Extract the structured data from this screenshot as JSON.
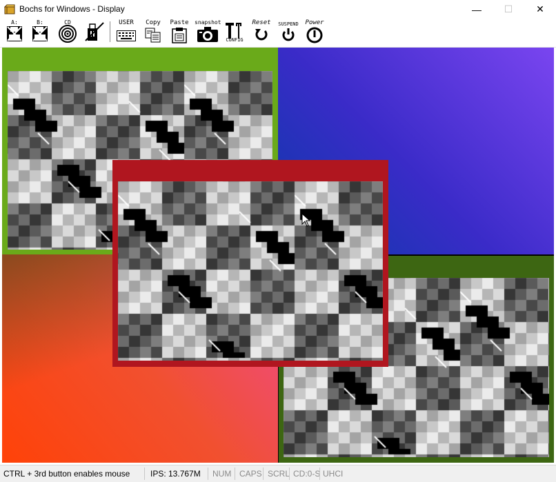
{
  "window": {
    "title": "Bochs for Windows - Display",
    "controls": {
      "minimize": "—",
      "maximize": "☐",
      "close": "✕"
    }
  },
  "toolbar": {
    "buttons": [
      {
        "id": "floppy-a",
        "label": "A:",
        "icon": "floppy-icon"
      },
      {
        "id": "floppy-b",
        "label": "B:",
        "icon": "floppy-icon"
      },
      {
        "id": "cdrom",
        "label": "CD",
        "icon": "cd-icon"
      },
      {
        "id": "usb",
        "label": "",
        "icon": "usb-icon"
      },
      {
        "id": "user",
        "label": "USER",
        "icon": "keyboard-icon"
      },
      {
        "id": "copy",
        "label": "Copy",
        "icon": "copy-icon"
      },
      {
        "id": "paste",
        "label": "Paste",
        "icon": "paste-icon"
      },
      {
        "id": "snapshot",
        "label": "snapshot",
        "icon": "camera-icon"
      },
      {
        "id": "config",
        "label": "CONFIG",
        "icon": "tools-icon"
      },
      {
        "id": "reset",
        "label": "Reset",
        "icon": "reset-icon"
      },
      {
        "id": "suspend",
        "label": "SUSPEND",
        "icon": "suspend-icon"
      },
      {
        "id": "power",
        "label": "Power",
        "icon": "power-icon"
      }
    ]
  },
  "display": {
    "quadrant_colors": {
      "top_left": "#000000",
      "top_right_from": "#0a3aa8",
      "top_right_to": "#7a45f0",
      "bottom_left_from": "#8a4a1e",
      "bottom_left_to": "#ee4a90",
      "bottom_right": "#000000"
    },
    "windows": [
      {
        "name": "green-window",
        "frame_color": "#6aaa1a"
      },
      {
        "name": "red-window",
        "frame_color": "#b0161f"
      },
      {
        "name": "dark-green-window",
        "frame_color": "#3d6612"
      }
    ]
  },
  "status": {
    "hint": "CTRL + 3rd button enables mouse",
    "ips": "IPS: 13.767M",
    "num": "NUM",
    "caps": "CAPS",
    "scrl": "SCRL",
    "cd": "CD:0-S",
    "uhci": "UHCI"
  }
}
